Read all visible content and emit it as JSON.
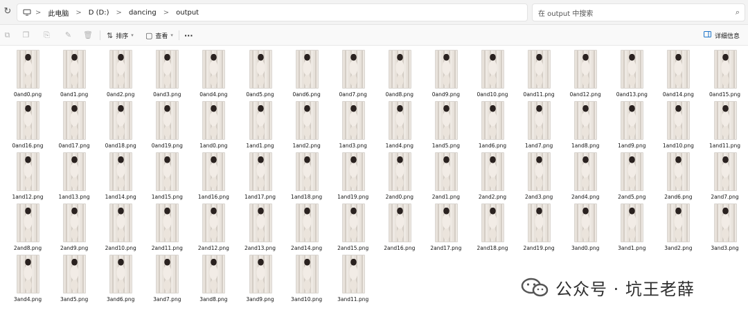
{
  "address": {
    "breadcrumbs": [
      "此电脑",
      "D (D:)",
      "dancing",
      "output"
    ],
    "search_placeholder": "在 output 中搜索"
  },
  "toolbar": {
    "sort_label": "排序",
    "view_label": "查看",
    "more_label": "···",
    "details_label": "详细信息"
  },
  "files": [
    "0and0.png",
    "0and1.png",
    "0and2.png",
    "0and3.png",
    "0and4.png",
    "0and5.png",
    "0and6.png",
    "0and7.png",
    "0and8.png",
    "0and9.png",
    "0and10.png",
    "0and11.png",
    "0and12.png",
    "0and13.png",
    "0and14.png",
    "0and15.png",
    "0and16.png",
    "0and17.png",
    "0and18.png",
    "0and19.png",
    "1and0.png",
    "1and1.png",
    "1and2.png",
    "1and3.png",
    "1and4.png",
    "1and5.png",
    "1and6.png",
    "1and7.png",
    "1and8.png",
    "1and9.png",
    "1and10.png",
    "1and11.png",
    "1and12.png",
    "1and13.png",
    "1and14.png",
    "1and15.png",
    "1and16.png",
    "1and17.png",
    "1and18.png",
    "1and19.png",
    "2and0.png",
    "2and1.png",
    "2and2.png",
    "2and3.png",
    "2and4.png",
    "2and5.png",
    "2and6.png",
    "2and7.png",
    "2and8.png",
    "2and9.png",
    "2and10.png",
    "2and11.png",
    "2and12.png",
    "2and13.png",
    "2and14.png",
    "2and15.png",
    "2and16.png",
    "2and17.png",
    "2and18.png",
    "2and19.png",
    "3and0.png",
    "3and1.png",
    "3and2.png",
    "3and3.png",
    "3and4.png",
    "3and5.png",
    "3and6.png",
    "3and7.png",
    "3and8.png",
    "3and9.png",
    "3and10.png",
    "3and11.png"
  ],
  "watermark": {
    "text": "公众号 · 坑王老薛"
  }
}
